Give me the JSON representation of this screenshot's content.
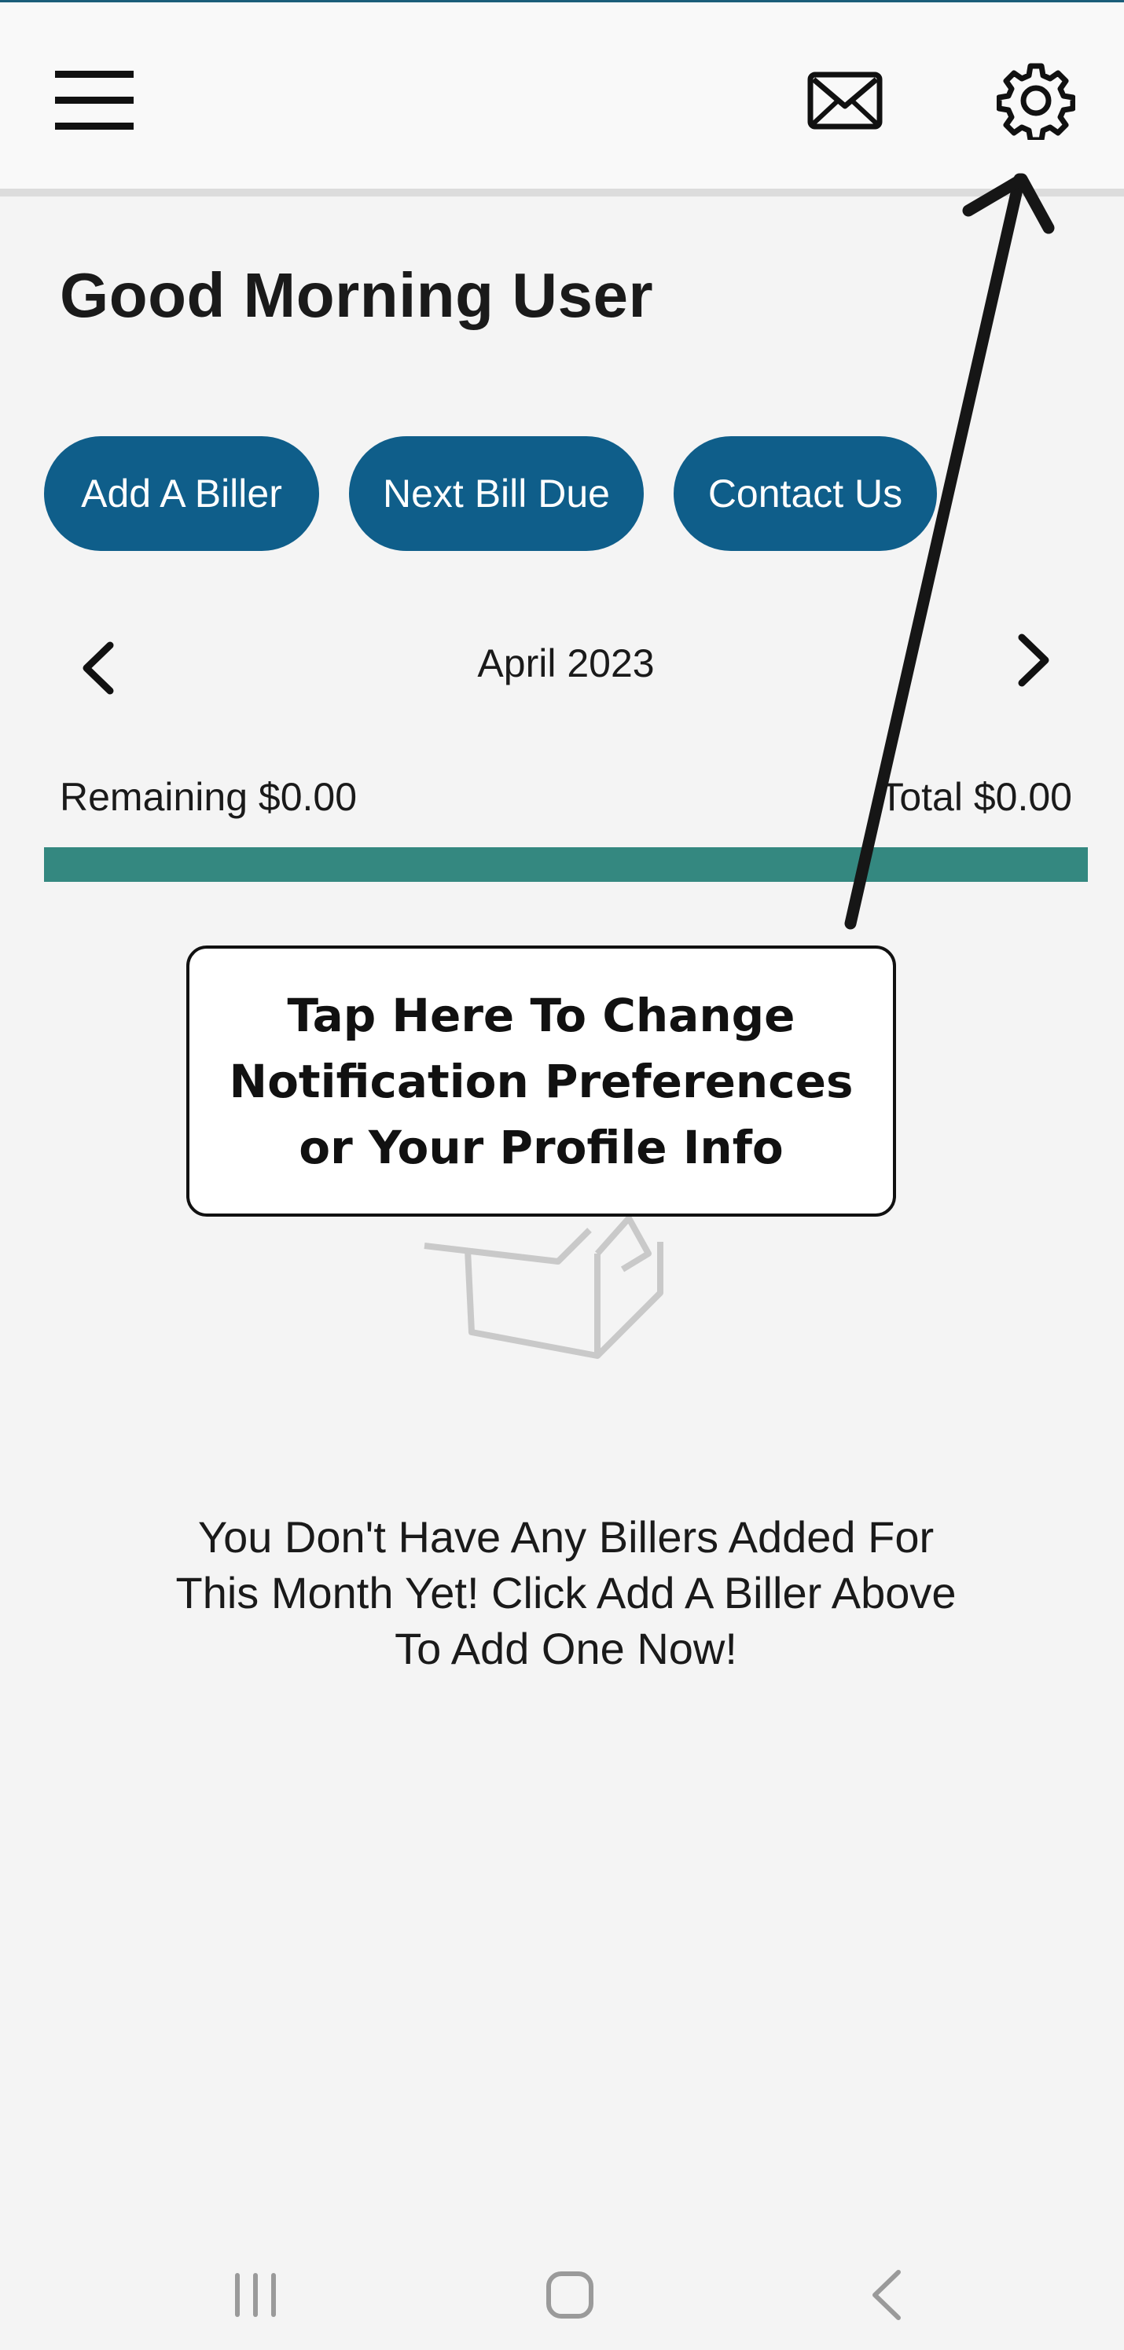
{
  "header": {
    "menu_icon": "hamburger-menu-icon",
    "mail_icon": "envelope-icon",
    "settings_icon": "gear-icon"
  },
  "greeting": "Good Morning User",
  "actions": [
    {
      "label": "Add A Biller"
    },
    {
      "label": "Next Bill Due"
    },
    {
      "label": "Contact Us"
    }
  ],
  "period": {
    "month": "April 2023",
    "prev_icon": "chevron-left-icon",
    "next_icon": "chevron-right-icon"
  },
  "summary": {
    "remaining": "Remaining $0.00",
    "total": "Total $0.00",
    "progress_fraction": 1.0
  },
  "callout": {
    "text": "Tap Here To Change Notification Preferences or Your Profile Info"
  },
  "empty_state": {
    "icon": "open-box-icon",
    "message": "You Don't Have Any Billers Added For This Month Yet! Click Add A Biller Above To Add One Now!"
  },
  "colors": {
    "primary": "#0f5e8a",
    "progress": "#348880",
    "background": "#f4f4f4"
  },
  "system_nav": {
    "icons": [
      "recents-icon",
      "home-icon",
      "back-icon"
    ]
  }
}
